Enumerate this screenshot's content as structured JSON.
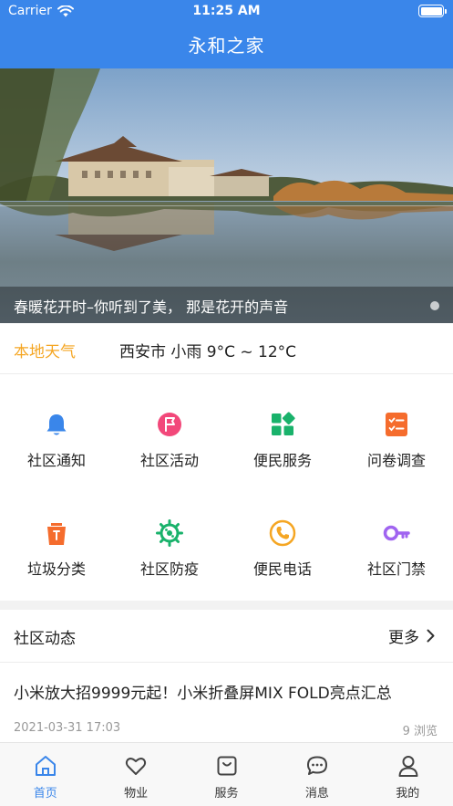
{
  "status_bar": {
    "carrier": "Carrier",
    "time": "11:25 AM"
  },
  "nav": {
    "title": "永和之家"
  },
  "banner": {
    "caption": "春暖花开时–你听到了美，  那是花开的声音"
  },
  "weather": {
    "label": "本地天气",
    "info": "西安市 小雨  9°C ~ 12°C"
  },
  "services": [
    {
      "label": "社区通知",
      "icon": "bell-icon",
      "color": "#3a86ea"
    },
    {
      "label": "社区活动",
      "icon": "flag-icon",
      "color": "#f2487a"
    },
    {
      "label": "便民服务",
      "icon": "apps-icon",
      "color": "#19b26b"
    },
    {
      "label": "问卷调查",
      "icon": "checklist-icon",
      "color": "#f56c2d"
    },
    {
      "label": "垃圾分类",
      "icon": "trash-can-icon",
      "color": "#f56c2d"
    },
    {
      "label": "社区防疫",
      "icon": "virus-icon",
      "color": "#19b26b"
    },
    {
      "label": "便民电话",
      "icon": "phone-icon",
      "color": "#f5a623"
    },
    {
      "label": "社区门禁",
      "icon": "key-icon",
      "color": "#a064f0"
    }
  ],
  "news": {
    "section_title": "社区动态",
    "more_label": "更多",
    "item": {
      "headline": "小米放大招9999元起！小米折叠屏MIX FOLD亮点汇总",
      "date": "2021-03-31 17:03",
      "views": "9 浏览"
    }
  },
  "tabs": [
    {
      "label": "首页",
      "icon": "home-icon",
      "active": true
    },
    {
      "label": "物业",
      "icon": "heart-icon",
      "active": false
    },
    {
      "label": "服务",
      "icon": "bag-icon",
      "active": false
    },
    {
      "label": "消息",
      "icon": "chat-icon",
      "active": false
    },
    {
      "label": "我的",
      "icon": "user-icon",
      "active": false
    }
  ],
  "colors": {
    "primary": "#3a86ea",
    "weather_label": "#f5a623"
  }
}
